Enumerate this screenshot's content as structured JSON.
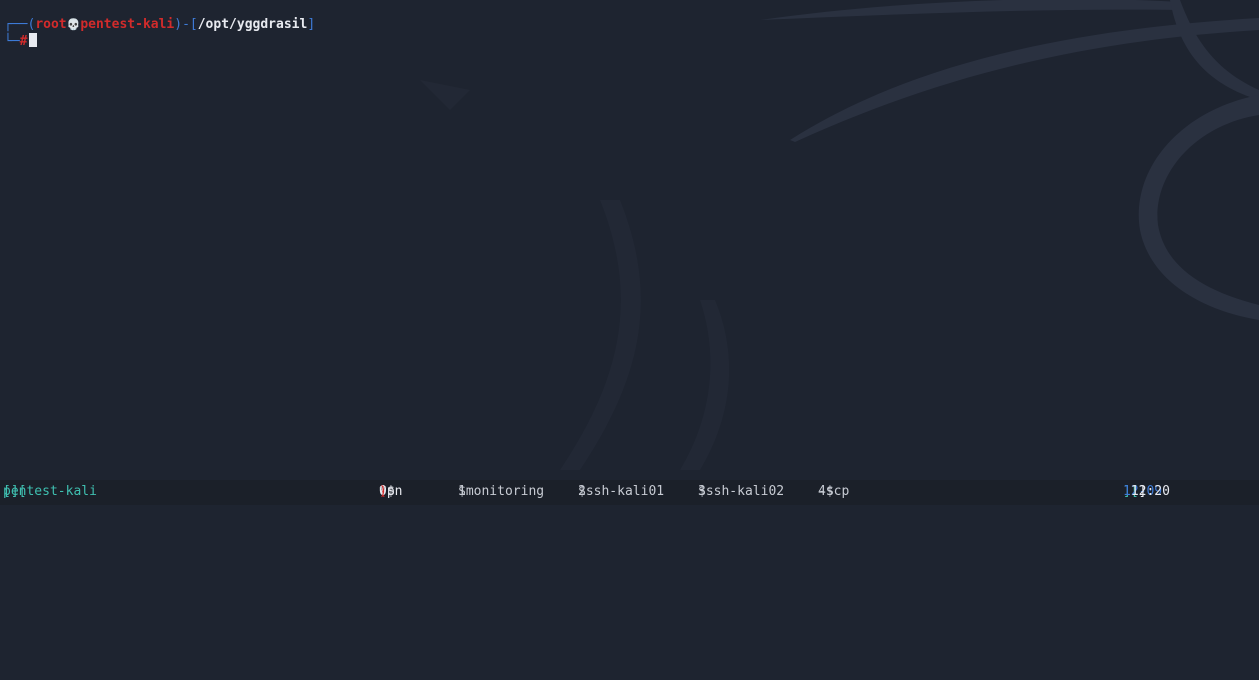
{
  "prompt": {
    "corner_top": "┌──(",
    "user": "root",
    "skull_icon": "💀",
    "host": "pentest-kali",
    "mid_separator": ")-[",
    "path": "/opt/yggdrasil",
    "end_bracket": "]",
    "corner_bottom": "└─",
    "symbol": "#"
  },
  "statusbar": {
    "left_open": "[ ",
    "session": "pentest-kali",
    "left_close": " ][",
    "windows": [
      {
        "index": "0",
        "flag": "*$",
        "name": "vpn",
        "active": true
      },
      {
        "index": "1",
        "flag": "$",
        "name": "monitoring",
        "active": false
      },
      {
        "index": "2",
        "flag": "$",
        "name": "ssh-kali01",
        "active": false
      },
      {
        "index": "3",
        "flag": "$",
        "name": "ssh-kali02",
        "active": false
      },
      {
        "index": "4",
        "flag": "-$",
        "name": "scp",
        "active": false
      }
    ],
    "right_open": "][ ",
    "date": "12-09",
    "time": "12:20",
    "right_close": " ]"
  },
  "colors": {
    "background": "#1e2430",
    "prompt_blue": "#3d7ad6",
    "prompt_red": "#d22b2b",
    "session_teal": "#3fbfb0"
  }
}
